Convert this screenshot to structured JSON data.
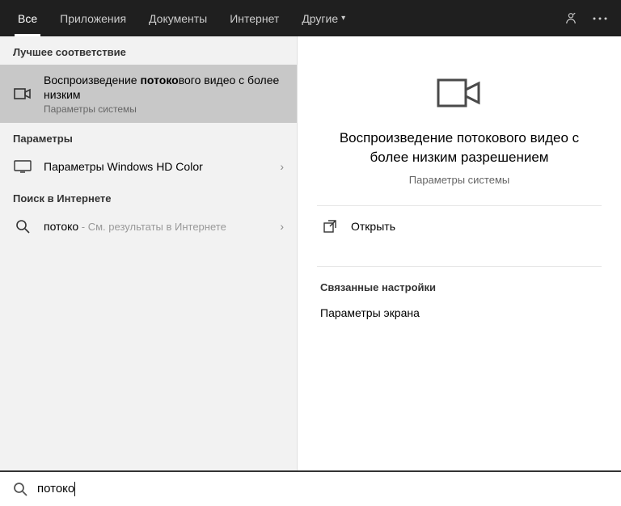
{
  "header": {
    "tabs": [
      {
        "label": "Все",
        "active": true
      },
      {
        "label": "Приложения",
        "active": false
      },
      {
        "label": "Документы",
        "active": false
      },
      {
        "label": "Интернет",
        "active": false
      },
      {
        "label": "Другие",
        "active": false,
        "dropdown": true
      }
    ]
  },
  "left": {
    "best_match_header": "Лучшее соответствие",
    "best_match": {
      "title_prefix": "Воспроизведение ",
      "title_bold": "потоко",
      "title_suffix": "вого видео с более низким",
      "subtitle": "Параметры системы"
    },
    "settings_header": "Параметры",
    "settings_item": {
      "label": "Параметры Windows HD Color"
    },
    "web_header": "Поиск в Интернете",
    "web_item": {
      "query": "потоко",
      "tail": " - См. результаты в Интернете"
    }
  },
  "right": {
    "title": "Воспроизведение потокового видео с более низким разрешением",
    "subtitle": "Параметры системы",
    "open_label": "Открыть",
    "related_header": "Связанные настройки",
    "related_item": "Параметры экрана"
  },
  "search": {
    "value": "потоко"
  }
}
